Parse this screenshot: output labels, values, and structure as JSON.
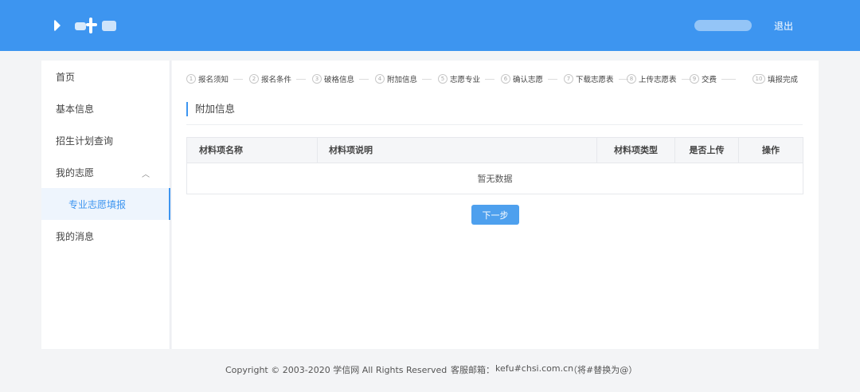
{
  "header": {
    "logout_label": "退出"
  },
  "sidebar": {
    "items": [
      {
        "label": "首页"
      },
      {
        "label": "基本信息"
      },
      {
        "label": "招生计划查询"
      },
      {
        "label": "我的志愿"
      },
      {
        "label": "专业志愿填报"
      },
      {
        "label": "我的消息"
      }
    ]
  },
  "steps": [
    {
      "num": "1",
      "label": "报名须知"
    },
    {
      "num": "2",
      "label": "报名条件"
    },
    {
      "num": "3",
      "label": "破格信息"
    },
    {
      "num": "4",
      "label": "附加信息"
    },
    {
      "num": "5",
      "label": "志愿专业"
    },
    {
      "num": "6",
      "label": "确认志愿"
    },
    {
      "num": "7",
      "label": "下载志愿表"
    },
    {
      "num": "8",
      "label": "上传志愿表"
    },
    {
      "num": "9",
      "label": "交费"
    },
    {
      "num": "10",
      "label": "填报完成"
    }
  ],
  "main": {
    "section_title": "附加信息",
    "table": {
      "columns": [
        "材料项名称",
        "材料项说明",
        "材料项类型",
        "是否上传",
        "操作"
      ],
      "empty_text": "暂无数据"
    },
    "next_button": "下一步"
  },
  "footer": {
    "copyright": "Copyright © 2003-2020 学信网 All Rights Reserved",
    "mail_label": "客服邮箱：",
    "mail": "kefu#chsi.com.cn",
    "note": "（将#替换为@）"
  },
  "colors": {
    "header_bg": "#3d95f0",
    "accent": "#3d95f0",
    "button_bg": "#4ea0ee"
  }
}
